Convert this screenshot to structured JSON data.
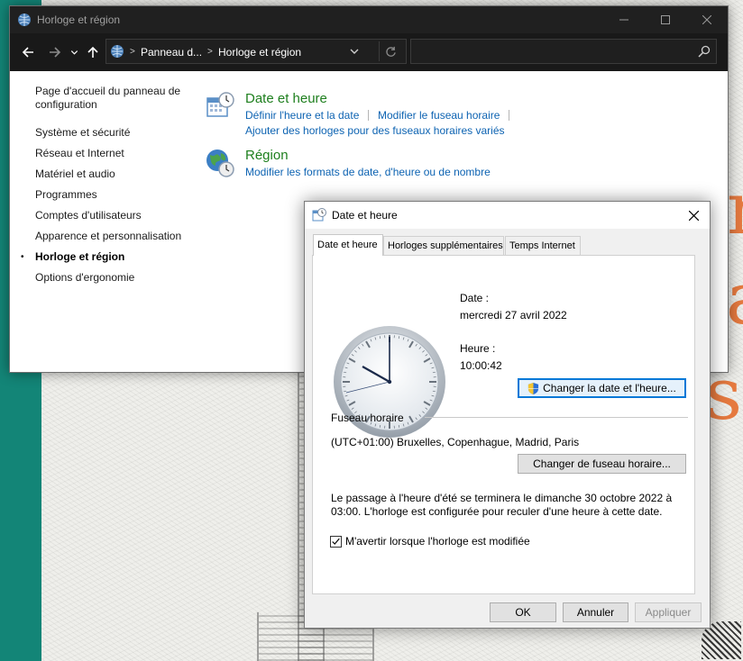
{
  "colors": {
    "teal": "#138577",
    "link_blue": "#0d63b2",
    "category_green": "#1e7f1e",
    "dark_titlebar": "#202020",
    "orange_letters": "#e5793f"
  },
  "desktop": {
    "letters": [
      "n",
      "a",
      "se"
    ]
  },
  "control_panel": {
    "title": "Horloge et région",
    "icon": "control-panel-globe-icon",
    "window_buttons": [
      "minimize-icon",
      "maximize-icon",
      "close-icon"
    ],
    "nav": {
      "back": "back-arrow-icon",
      "forward": "forward-arrow-icon",
      "recent": "chevron-down-icon",
      "up": "up-arrow-icon"
    },
    "address": {
      "crumbs": [
        "Panneau d...",
        "Horloge et région"
      ],
      "separator": ">"
    },
    "search": {
      "placeholder": ""
    },
    "sidebar": {
      "home": "Page d'accueil du panneau de configuration",
      "items": [
        {
          "label": "Système et sécurité",
          "active": false
        },
        {
          "label": "Réseau et Internet",
          "active": false
        },
        {
          "label": "Matériel et audio",
          "active": false
        },
        {
          "label": "Programmes",
          "active": false
        },
        {
          "label": "Comptes d'utilisateurs",
          "active": false
        },
        {
          "label": "Apparence et personnalisation",
          "active": false
        },
        {
          "label": "Horloge et région",
          "active": true
        },
        {
          "label": "Options d'ergonomie",
          "active": false
        }
      ],
      "bullet": "•"
    },
    "categories": [
      {
        "title": "Date et heure",
        "icon": "calendar-clock-icon",
        "links": [
          "Définir l'heure et la date",
          "Modifier le fuseau horaire",
          "Ajouter des horloges pour des fuseaux horaires variés"
        ]
      },
      {
        "title": "Région",
        "icon": "globe-clock-icon",
        "links": [
          "Modifier les formats de date, d'heure ou de nombre"
        ]
      }
    ]
  },
  "dialog": {
    "title": "Date et heure",
    "icon": "date-time-icon",
    "tabs": [
      {
        "label": "Date et heure",
        "selected": true
      },
      {
        "label": "Horloges supplémentaires",
        "selected": false
      },
      {
        "label": "Temps Internet",
        "selected": false
      }
    ],
    "date_label": "Date :",
    "date_value": "mercredi 27 avril 2022",
    "time_label": "Heure :",
    "time_value": "10:00:42",
    "change_datetime_button": "Changer la date et l'heure...",
    "shield_icon": "uac-shield-icon",
    "timezone_group": "Fuseau horaire",
    "timezone_value": "(UTC+01:00) Bruxelles, Copenhague, Madrid, Paris",
    "change_timezone_button": "Changer de fuseau horaire...",
    "dst_notice": "Le passage à l'heure d'été se terminera le dimanche 30 octobre 2022 à 03:00. L'horloge est configurée pour reculer d'une heure à cette date.",
    "notify_checkbox": {
      "label": "M'avertir lorsque l'horloge est modifiée",
      "checked": true
    },
    "buttons": {
      "ok": "OK",
      "cancel": "Annuler",
      "apply": "Appliquer"
    }
  }
}
